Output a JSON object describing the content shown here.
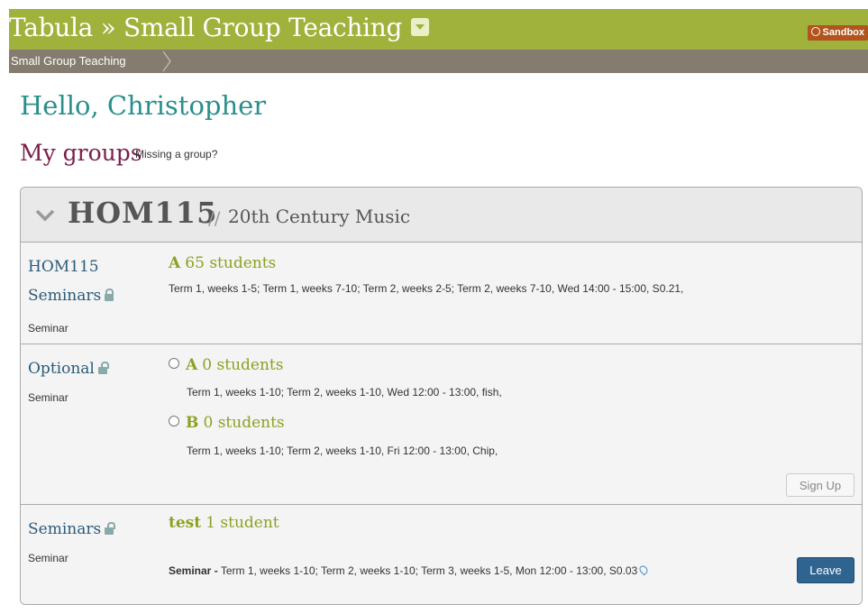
{
  "header": {
    "app_title": "Tabula » Small Group Teaching",
    "sandbox_label": "Sandbox"
  },
  "breadcrumb": [
    "Small Group Teaching"
  ],
  "greeting": "Hello, Christopher",
  "my_groups": {
    "heading": "My groups",
    "missing_link": "Missing a group?"
  },
  "module": {
    "code": "HOM115",
    "separator": "//",
    "name": "20th Century Music",
    "sets": [
      {
        "name_line1": "HOM115",
        "name_line2": "Seminars",
        "locked": true,
        "format": "Seminar",
        "groups": [
          {
            "letter": "A",
            "count": "65 students",
            "detail": "Term 1, weeks 1-5; Term 1, weeks 7-10; Term 2, weeks 2-5; Term 2, weeks 7-10, Wed 14:00 - 15:00, S0.21,"
          }
        ]
      },
      {
        "name": "Optional",
        "locked": false,
        "format": "Seminar",
        "groups": [
          {
            "letter": "A",
            "count": "0 students",
            "detail": "Term 1, weeks 1-10; Term 2, weeks 1-10, Wed 12:00 - 13:00, fish,"
          },
          {
            "letter": "B",
            "count": "0 students",
            "detail": "Term 1, weeks 1-10; Term 2, weeks 1-10, Fri 12:00 - 13:00, Chip,"
          }
        ],
        "action": "Sign Up"
      },
      {
        "name": "Seminars",
        "locked": false,
        "format": "Seminar",
        "groups": [
          {
            "letter": "test",
            "count": "1 student",
            "event_label": "Seminar -",
            "detail": "Term 1, weeks 1-10; Term 2, weeks 1-10; Term 3, weeks 1-5, Mon 12:00 - 13:00, S0.03"
          }
        ],
        "action": "Leave"
      }
    ]
  },
  "colors": {
    "header_green": "#a0b23c",
    "breadcrumb_brown": "#857c70",
    "greeting_teal": "#2a8f8b",
    "groups_heading_maroon": "#7a1f4b",
    "group_green": "#8ea021",
    "link_blue": "#2b5a7a",
    "sandbox_orange": "#b1541d",
    "leave_button_blue": "#2f6490"
  },
  "icons": {
    "title_menu": "caret-down-icon",
    "sandbox": "sandbox-icon",
    "collapse": "chevron-down-icon",
    "locked": "lock-icon",
    "unlocked": "unlock-icon",
    "location": "map-pin-icon"
  }
}
